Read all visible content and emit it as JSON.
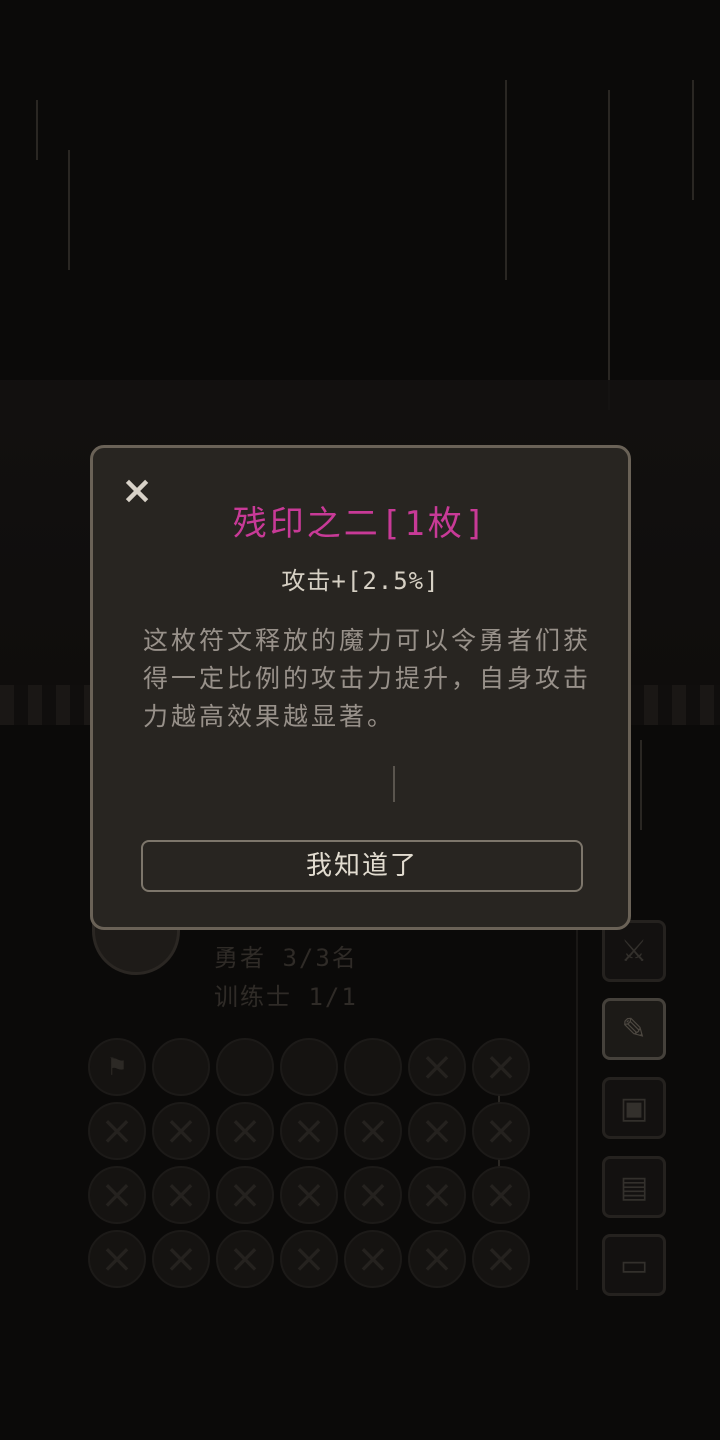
{
  "modal": {
    "title": "残印之二[1枚]",
    "stat": "攻击+[2.5%]",
    "description": "这枚符文释放的魔力可以令勇者们获得一定比例的攻击力提升，自身攻击力越高效果越显著。",
    "confirm_label": "我知道了",
    "close_icon": "×",
    "title_color": "#c83a97"
  },
  "background": {
    "heroes_line": "勇者 3/3名",
    "trainer_line": "训练士 1/1"
  },
  "side_buttons": [
    {
      "icon": "sword-icon",
      "glyph": "⚔"
    },
    {
      "icon": "scroll-icon",
      "glyph": "✎"
    },
    {
      "icon": "map-icon",
      "glyph": "▣"
    },
    {
      "icon": "document-icon",
      "glyph": "▤"
    },
    {
      "icon": "computer-icon",
      "glyph": "▭"
    }
  ]
}
